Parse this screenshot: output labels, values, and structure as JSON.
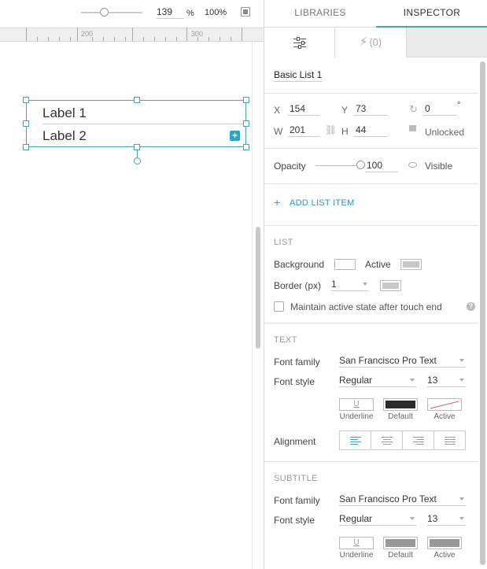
{
  "toolbar": {
    "zoom_value": "139",
    "zoom_unit": "%",
    "zoom_reset": "100%",
    "zoom_slider_level_pct": 30
  },
  "ruler": {
    "marks": [
      "200",
      "300"
    ]
  },
  "canvas": {
    "list_items": [
      "Label 1",
      "Label 2"
    ]
  },
  "tabs": {
    "libraries": "LIBRARIES",
    "inspector": "INSPECTOR",
    "events": "(0)"
  },
  "inspector": {
    "name": "Basic List 1",
    "x_label": "X",
    "x": "154",
    "y_label": "Y",
    "y": "73",
    "w_label": "W",
    "w": "201",
    "h_label": "H",
    "h": "44",
    "rotation": "0",
    "rotation_unit": "°",
    "lock_label": "Unlocked",
    "opacity_label": "Opacity",
    "opacity": "100",
    "visible_label": "Visible",
    "add_item": "ADD LIST ITEM",
    "list": {
      "title": "LIST",
      "background_label": "Background",
      "active_label": "Active",
      "border_label": "Border (px)",
      "border_value": "1",
      "maintain_label": "Maintain active state after touch end",
      "maintain_checked": false,
      "background_color": "#ffffff",
      "active_color": "#c8c8c8",
      "border_color": "#c8c8c8"
    },
    "text": {
      "title": "TEXT",
      "font_family_label": "Font family",
      "font_family": "San Francisco Pro Text",
      "font_style_label": "Font style",
      "font_style": "Regular",
      "font_size": "13",
      "underline_label": "Underline",
      "default_label": "Default",
      "active_label": "Active",
      "alignment_label": "Alignment",
      "underline_glyph": "U",
      "default_color": "#2b2b2b"
    },
    "subtitle": {
      "title": "SUBTITLE",
      "font_family_label": "Font family",
      "font_family": "San Francisco Pro Text",
      "font_style_label": "Font style",
      "font_style": "Regular",
      "font_size": "13",
      "underline_label": "Underline",
      "default_label": "Default",
      "active_label": "Active",
      "underline_glyph": "U",
      "default_color": "#999999",
      "active_color": "#999999"
    }
  },
  "colors": {
    "accent": "#4aa3b5",
    "plus_button": "#2ea3c4"
  }
}
